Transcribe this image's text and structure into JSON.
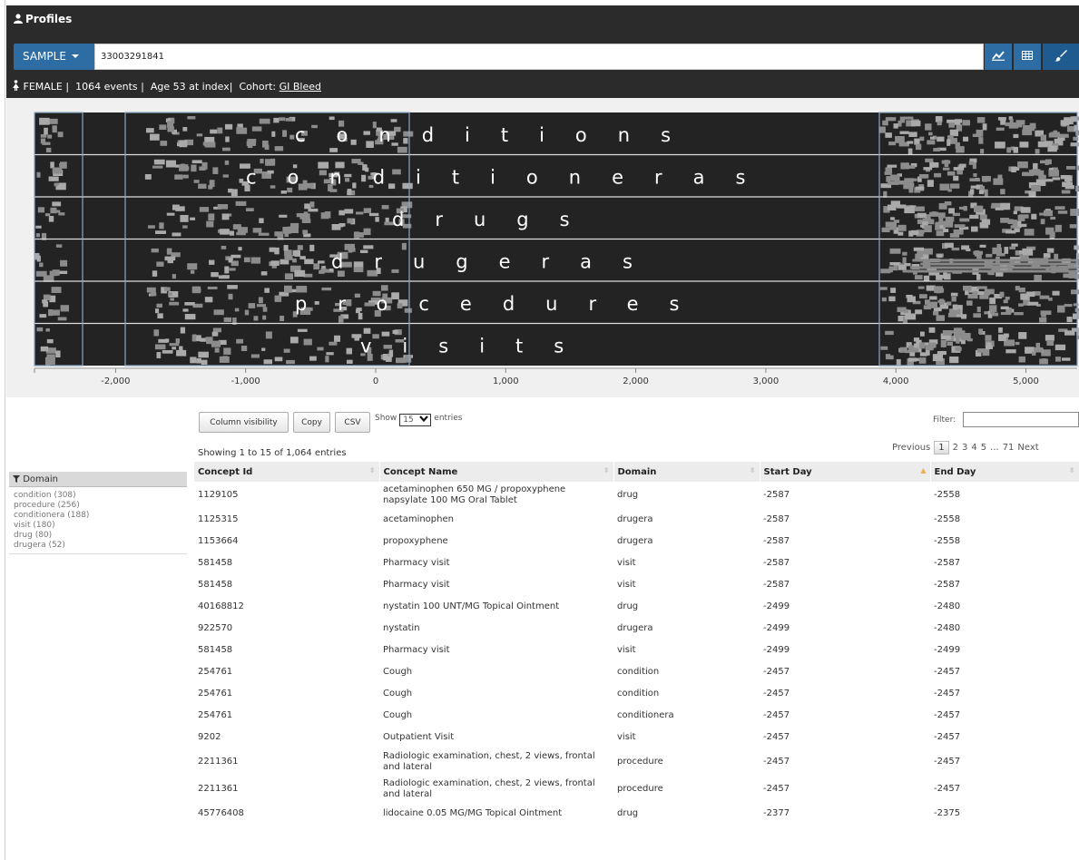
{
  "header": {
    "title": "Profiles"
  },
  "toolbar": {
    "sample_label": "SAMPLE",
    "person_id": "33003291841"
  },
  "patient": {
    "gender": "FEMALE",
    "events": "1064 events",
    "age": "Age 53 at index",
    "cohort_label": "Cohort:",
    "cohort_name": "GI Bleed"
  },
  "timeline": {
    "domain_labels": [
      "conditions",
      "conditioneras",
      "drugs",
      "drugeras",
      "procedures",
      "visits"
    ],
    "x_ticks": [
      "-2,000",
      "-1,000",
      "0",
      "1,000",
      "2,000",
      "3,000",
      "4,000",
      "5,000"
    ]
  },
  "facets": {
    "title": "Domain",
    "items": [
      "condition (308)",
      "procedure (256)",
      "conditionera (188)",
      "visit (180)",
      "drug (80)",
      "drugera (52)"
    ]
  },
  "table_controls": {
    "column_visibility": "Column visibility",
    "copy": "Copy",
    "csv": "CSV",
    "show_label": "Show",
    "show_value": "15",
    "entries_label": "entries",
    "filter_label": "Filter:",
    "showing": "Showing 1 to 15 of 1,064 entries",
    "pagination": {
      "previous": "Previous",
      "current": "1",
      "pages": [
        "2",
        "3",
        "4",
        "5",
        "...",
        "71"
      ],
      "next": "Next"
    }
  },
  "table": {
    "columns": [
      "Concept Id",
      "Concept Name",
      "Domain",
      "Start Day",
      "End Day"
    ],
    "rows": [
      [
        "1129105",
        "acetaminophen 650 MG / propoxyphene napsylate 100 MG Oral Tablet",
        "drug",
        "-2587",
        "-2558"
      ],
      [
        "1125315",
        "acetaminophen",
        "drugera",
        "-2587",
        "-2558"
      ],
      [
        "1153664",
        "propoxyphene",
        "drugera",
        "-2587",
        "-2558"
      ],
      [
        "581458",
        "Pharmacy visit",
        "visit",
        "-2587",
        "-2587"
      ],
      [
        "581458",
        "Pharmacy visit",
        "visit",
        "-2587",
        "-2587"
      ],
      [
        "40168812",
        "nystatin 100 UNT/MG Topical Ointment",
        "drug",
        "-2499",
        "-2480"
      ],
      [
        "922570",
        "nystatin",
        "drugera",
        "-2499",
        "-2480"
      ],
      [
        "581458",
        "Pharmacy visit",
        "visit",
        "-2499",
        "-2499"
      ],
      [
        "254761",
        "Cough",
        "condition",
        "-2457",
        "-2457"
      ],
      [
        "254761",
        "Cough",
        "condition",
        "-2457",
        "-2457"
      ],
      [
        "254761",
        "Cough",
        "conditionera",
        "-2457",
        "-2457"
      ],
      [
        "9202",
        "Outpatient Visit",
        "visit",
        "-2457",
        "-2457"
      ],
      [
        "2211361",
        "Radiologic examination, chest, 2 views, frontal and lateral",
        "procedure",
        "-2457",
        "-2457"
      ],
      [
        "2211361",
        "Radiologic examination, chest, 2 views, frontal and lateral",
        "procedure",
        "-2457",
        "-2457"
      ],
      [
        "45776408",
        "lidocaine 0.05 MG/MG Topical Ointment",
        "drug",
        "-2377",
        "-2375"
      ]
    ]
  }
}
